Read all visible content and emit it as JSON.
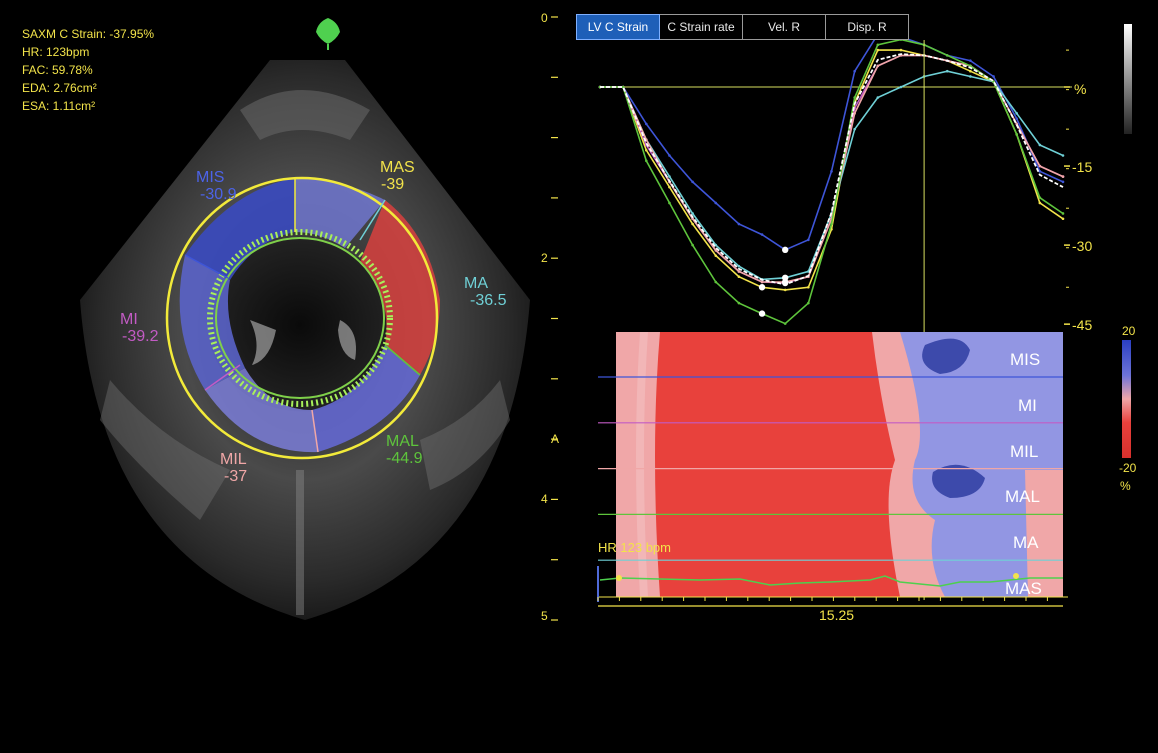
{
  "readout": {
    "line1": "SAXM C Strain: -37.95%",
    "line2": "HR:   123bpm",
    "line3": "FAC: 59.78%",
    "line4": "EDA: 2.76cm²",
    "line5": "ESA: 1.11cm²"
  },
  "segments": {
    "mis": {
      "name": "MIS",
      "value": "-30.9"
    },
    "mas": {
      "name": "MAS",
      "value": "-39"
    },
    "ma": {
      "name": "MA",
      "value": "-36.5"
    },
    "mi": {
      "name": "MI",
      "value": "-39.2"
    },
    "mil": {
      "name": "MIL",
      "value": "-37"
    },
    "mal": {
      "name": "MAL",
      "value": "-44.9"
    }
  },
  "tabs": [
    {
      "label": "LV C Strain",
      "active": true
    },
    {
      "label": "C Strain rate",
      "active": false
    },
    {
      "label": "Vel. R",
      "active": false
    },
    {
      "label": "Disp. R",
      "active": false
    }
  ],
  "depth_scale": {
    "labels": [
      "0",
      "2",
      "4",
      "5"
    ],
    "marker": "A"
  },
  "strain_axis": {
    "unit": "%",
    "ticks": [
      "-15",
      "-30",
      "-45"
    ]
  },
  "colorbar": {
    "top": "20",
    "bottom": "-20",
    "unit": "%"
  },
  "heatmap_rows": [
    "MIS",
    "MI",
    "MIL",
    "MAL",
    "MA",
    "MAS"
  ],
  "hr_label": "HR 123 bpm",
  "time_label": "15.25",
  "colors": {
    "mis": "#3e55d8",
    "mas": "#f2e34a",
    "ma": "#6fd0d6",
    "mi": "#c25bc4",
    "mil": "#f0a7a7",
    "mal": "#5ec43c",
    "heat_red": "#e8413c",
    "heat_pink": "#f0a7a8",
    "heat_blue": "#9296e3",
    "heat_dark_blue": "#3d4aab",
    "active_tab": "#1e5fb8",
    "contour": "#f2ea3a",
    "ecg": "#4dd04d"
  },
  "chart_data": {
    "type": "line",
    "ylabel": "%",
    "ylim": [
      -45,
      0
    ],
    "x": [
      0,
      5,
      10,
      15,
      20,
      25,
      30,
      35,
      40,
      45,
      50,
      55,
      60,
      65,
      70,
      75,
      80,
      85,
      90,
      95,
      100
    ],
    "series": [
      {
        "key": "mis",
        "values": [
          0,
          0,
          -7,
          -13,
          -18,
          -22,
          -26,
          -28,
          -30.9,
          -29,
          -16,
          3,
          10,
          9.5,
          8,
          6,
          5,
          2,
          -6,
          -16,
          -18
        ]
      },
      {
        "key": "mas",
        "values": [
          0,
          0,
          -12,
          -19,
          -26,
          -32,
          -36,
          -38,
          -38.5,
          -38,
          -27,
          -3,
          7,
          7,
          6,
          5,
          3,
          1,
          -9,
          -22,
          -25
        ]
      },
      {
        "key": "ma",
        "values": [
          0,
          0,
          -10,
          -17,
          -24,
          -30,
          -34,
          -36.5,
          -36.2,
          -35,
          -24,
          -8,
          -2,
          0,
          2,
          3,
          2,
          1,
          -5,
          -11,
          -13
        ]
      },
      {
        "key": "mi",
        "values": [
          0,
          0,
          -11,
          -18,
          -25,
          -31,
          -35,
          -37,
          -37.2,
          -36,
          -25,
          -4,
          4,
          6,
          6,
          5,
          4,
          1,
          -7,
          -15,
          -17
        ]
      },
      {
        "key": "mil",
        "values": [
          0,
          0,
          -10,
          -18,
          -25,
          -31,
          -35,
          -37,
          -37,
          -36,
          -25,
          -5,
          4,
          6,
          6,
          5,
          4,
          1,
          -7,
          -15,
          -17
        ]
      },
      {
        "key": "mal",
        "values": [
          0,
          0,
          -14,
          -22,
          -30,
          -37,
          -41,
          -43,
          -44.9,
          -41,
          -26,
          -2,
          8,
          9,
          8,
          6,
          4,
          1,
          -9,
          -21,
          -24
        ]
      }
    ],
    "markers": [
      {
        "key": "mis",
        "i": 8
      },
      {
        "key": "mas",
        "i": 7
      },
      {
        "key": "ma",
        "i": 8
      },
      {
        "key": "mi",
        "i": 8
      },
      {
        "key": "mil",
        "i": 8
      },
      {
        "key": "mal",
        "i": 7
      }
    ],
    "cursor_x": 70
  }
}
